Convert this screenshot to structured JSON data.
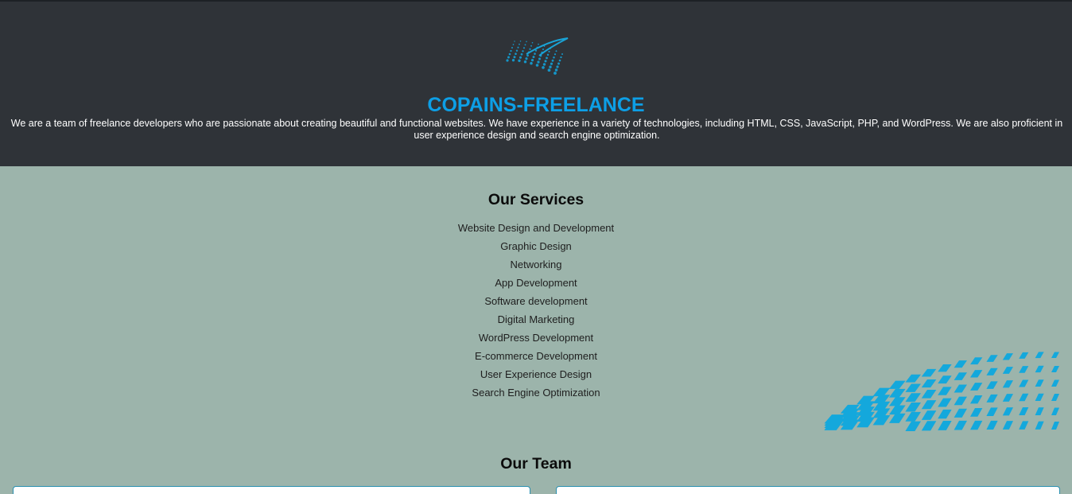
{
  "header": {
    "logo_icon": "wave-mesh-logo-icon",
    "brand_name": "COPAINS-FREELANCE",
    "brand_color": "#0d9fe6",
    "intro_text": "We are a team of freelance developers who are passionate about creating beautiful and functional websites. We have experience in a variety of technologies, including HTML, CSS, JavaScript, PHP, and WordPress. We are also proficient in user experience design and search engine optimization."
  },
  "services": {
    "title": "Our Services",
    "items": [
      "Website Design and Development",
      "Graphic Design",
      "Networking",
      "App Development",
      "Software development",
      "Digital Marketing",
      "WordPress Development",
      "E-commerce Development",
      "User Experience Design",
      "Search Engine Optimization"
    ],
    "decoration_icon": "wave-mesh-decoration-icon"
  },
  "team": {
    "title": "Our Team"
  },
  "colors": {
    "header_bg": "#2f3338",
    "page_bg": "#9cb4ab",
    "accent": "#0d9fe6"
  }
}
